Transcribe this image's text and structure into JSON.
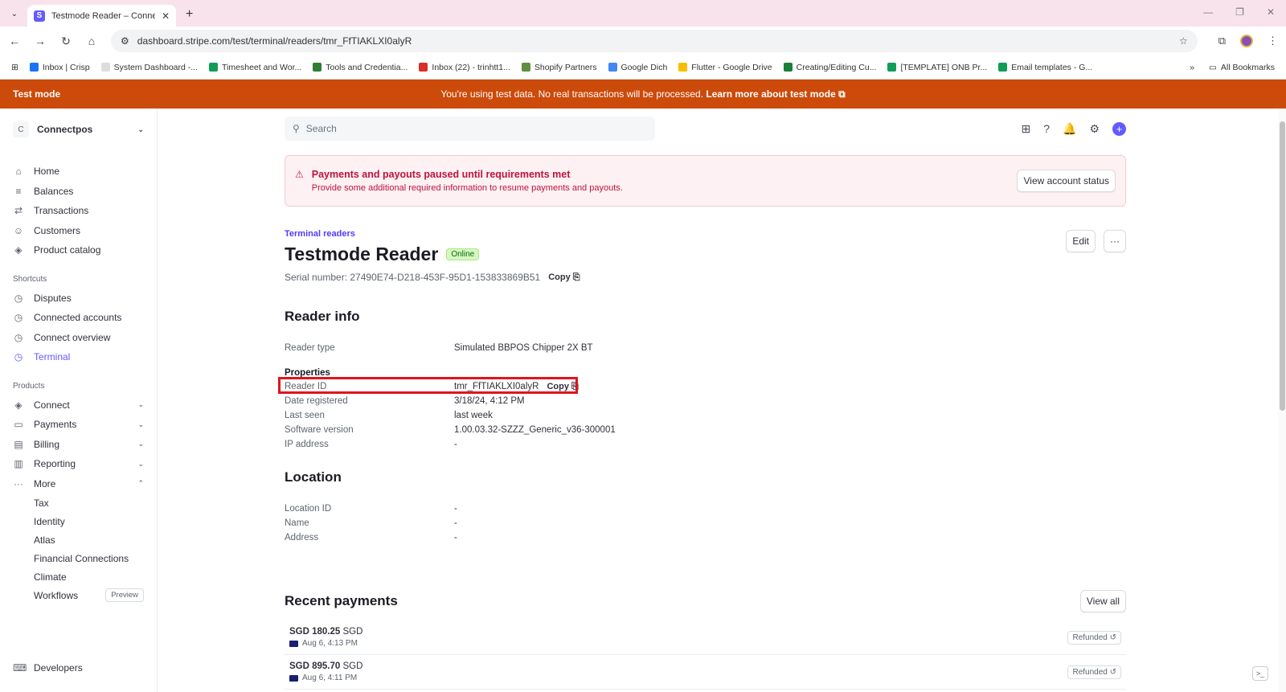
{
  "browser": {
    "tab_title": "Testmode Reader – Connectpos",
    "url": "dashboard.stripe.com/test/terminal/readers/tmr_FfTIAKLXI0alyR",
    "bookmarks": [
      {
        "label": "Inbox | Crisp",
        "color": "#1972f5"
      },
      {
        "label": "System Dashboard -...",
        "color": "#dddddd"
      },
      {
        "label": "Timesheet and Wor...",
        "color": "#0f9d58"
      },
      {
        "label": "Tools and Credentia...",
        "color": "#2e7d32"
      },
      {
        "label": "Inbox (22) - trinhtt1...",
        "color": "#d93025"
      },
      {
        "label": "Shopify Partners",
        "color": "#5e8e3e"
      },
      {
        "label": "Google Dich",
        "color": "#4285f4"
      },
      {
        "label": "Flutter - Google Drive",
        "color": "#fbbc04"
      },
      {
        "label": "Creating/Editing Cu...",
        "color": "#188038"
      },
      {
        "label": "[TEMPLATE] ONB Pr...",
        "color": "#0f9d58"
      },
      {
        "label": "Email templates - G...",
        "color": "#0f9d58"
      }
    ],
    "all_bookmarks": "All Bookmarks"
  },
  "banner": {
    "label": "Test mode",
    "message": "You're using test data. No real transactions will be processed.",
    "link": "Learn more about test mode"
  },
  "sidebar": {
    "account": "Connectpos",
    "account_initial": "C",
    "items": [
      {
        "label": "Home",
        "icon": "⌂"
      },
      {
        "label": "Balances",
        "icon": "≡"
      },
      {
        "label": "Transactions",
        "icon": "⇄"
      },
      {
        "label": "Customers",
        "icon": "☺"
      },
      {
        "label": "Product catalog",
        "icon": "◈"
      }
    ],
    "shortcuts_heading": "Shortcuts",
    "shortcuts": [
      {
        "label": "Disputes",
        "icon": "◷"
      },
      {
        "label": "Connected accounts",
        "icon": "◷"
      },
      {
        "label": "Connect overview",
        "icon": "◷"
      },
      {
        "label": "Terminal",
        "icon": "◷"
      }
    ],
    "products_heading": "Products",
    "products": [
      {
        "label": "Connect",
        "icon": "◈",
        "chev": "⌄"
      },
      {
        "label": "Payments",
        "icon": "▭",
        "chev": "⌄"
      },
      {
        "label": "Billing",
        "icon": "▤",
        "chev": "⌄"
      },
      {
        "label": "Reporting",
        "icon": "▥",
        "chev": "⌄"
      },
      {
        "label": "More",
        "icon": "···",
        "chev": "⌃"
      }
    ],
    "more_items": [
      "Tax",
      "Identity",
      "Atlas",
      "Financial Connections",
      "Climate",
      "Workflows"
    ],
    "preview_badge": "Preview",
    "developers": "Developers"
  },
  "header": {
    "search_placeholder": "Search"
  },
  "alert": {
    "title": "Payments and payouts paused until requirements met",
    "body": "Provide some additional required information to resume payments and payouts.",
    "button": "View account status"
  },
  "page": {
    "breadcrumb": "Terminal readers",
    "title": "Testmode Reader",
    "status": "Online",
    "edit": "Edit",
    "more": "···",
    "serial_label": "Serial number: 27490E74-D218-453F-95D1-153833869B51",
    "copy": "Copy"
  },
  "reader_info": {
    "heading": "Reader info",
    "reader_type_label": "Reader type",
    "reader_type": "Simulated BBPOS Chipper 2X BT",
    "properties_heading": "Properties",
    "rows": [
      {
        "k": "Reader ID",
        "v": "tmr_FfTIAKLXI0alyR"
      },
      {
        "k": "Date registered",
        "v": "3/18/24, 4:12 PM"
      },
      {
        "k": "Last seen",
        "v": "last week"
      },
      {
        "k": "Software version",
        "v": "1.00.03.32-SZZZ_Generic_v36-300001"
      },
      {
        "k": "IP address",
        "v": "-"
      }
    ]
  },
  "location": {
    "heading": "Location",
    "rows": [
      {
        "k": "Location ID",
        "v": "-"
      },
      {
        "k": "Name",
        "v": "-"
      },
      {
        "k": "Address",
        "v": "-"
      }
    ]
  },
  "recent": {
    "heading": "Recent payments",
    "view_all": "View all",
    "payments": [
      {
        "amount": "SGD 180.25",
        "currency": "SGD",
        "date": "Aug 6, 4:13 PM",
        "status": "Refunded ↺"
      },
      {
        "amount": "SGD 895.70",
        "currency": "SGD",
        "date": "Aug 6, 4:11 PM",
        "status": "Refunded ↺"
      }
    ]
  },
  "colors": {
    "accent": "#635bff",
    "test_banner": "#cc4a0a",
    "alert_text": "#c0123c",
    "highlight": "#e0141e"
  }
}
